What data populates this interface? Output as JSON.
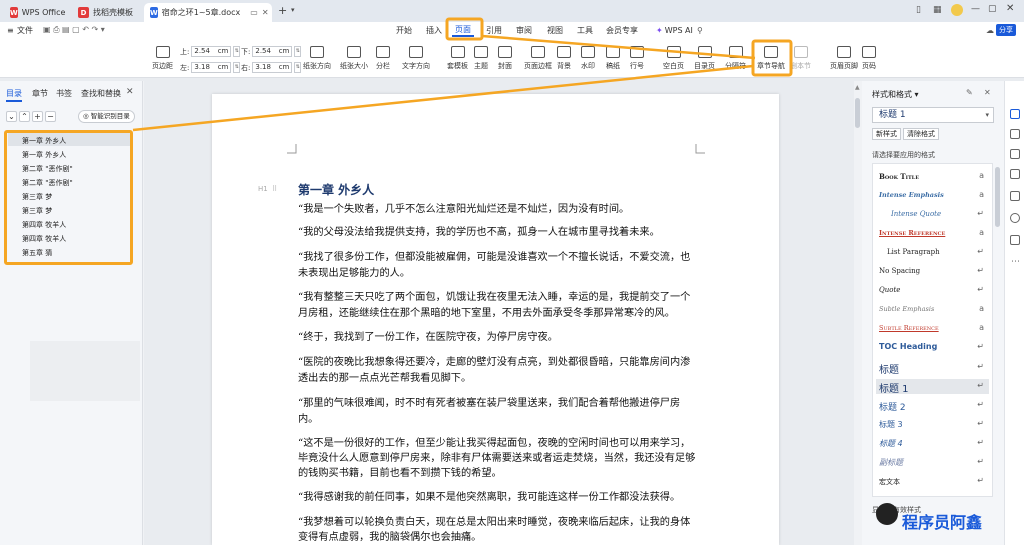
{
  "tabs": [
    {
      "label": "WPS Office",
      "icon": "wps-logo-icon"
    },
    {
      "label": "找稻壳模板",
      "icon": "docer-icon"
    },
    {
      "label": "宿命之环1~5章.docx",
      "icon": "word-doc-icon"
    }
  ],
  "menu": {
    "file": "文件",
    "items": [
      "开始",
      "插入",
      "页面",
      "引用",
      "审阅",
      "视图",
      "工具",
      "会员专享"
    ],
    "active": "页面",
    "wps_ai": "WPS AI",
    "share": "分享"
  },
  "ribbon": {
    "page_margin": "页边距",
    "top_label": "上:",
    "top_value": "2.54",
    "bottom_label": "下:",
    "bottom_value": "2.54",
    "left_label": "左:",
    "left_value": "3.18",
    "right_label": "右:",
    "right_value": "3.18",
    "unit": "cm",
    "buttons": [
      "纸张方向",
      "纸张大小",
      "分栏",
      "文字方向",
      "套模板",
      "主题",
      "封面",
      "页面边框",
      "背景",
      "水印",
      "稿纸",
      "行号",
      "空白页",
      "目录页",
      "分隔符",
      "章节导航",
      "删本节",
      "页眉页脚",
      "页码"
    ],
    "active_button": "章节导航",
    "disabled_button": "删本节"
  },
  "left_panel": {
    "tabs": [
      "目录",
      "章节",
      "书签",
      "查找和替换"
    ],
    "active_tab": "目录",
    "smart_toc": "智能识别目录",
    "toc_items": [
      "第一章 外乡人",
      "第一章 外乡人",
      "第二章 \"恶作剧\"",
      "第二章 \"恶作剧\"",
      "第三章 梦",
      "第三章 梦",
      "第四章 牧羊人",
      "第四章 牧羊人",
      "第五章 猜"
    ]
  },
  "document": {
    "heading_marker": "H1",
    "heading": "第一章 外乡人",
    "lines": [
      "“我是一个失败者，几乎不怎么注意阳光灿烂还是不灿烂，因为没有时间。",
      "“我的父母没法给我提供支持，我的学历也不高，孤身一人在城市里寻找着未来。",
      "“我找了很多份工作，但都没能被雇佣，可能是没谁喜欢一个不擅长说话，不爱交流，也",
      "未表现出足够能力的人。",
      "“我有整整三天只吃了两个面包，饥饿让我在夜里无法入睡，幸运的是，我提前交了一个",
      "月房租，还能继续住在那个黑暗的地下室里，不用去外面承受冬季那异常寒冷的风。",
      "“终于，我找到了一份工作，在医院守夜，为停尸房守夜。",
      "“医院的夜晚比我想象得还要冷，走廊的壁灯没有点亮，到处都很昏暗，只能靠房间内渗",
      "透出去的那一点点光芒帮我看见脚下。",
      "“那里的气味很难闻，时不时有死者被塞在装尸袋里送来，我们配合着帮他搬进停尸房",
      "内。",
      "“这不是一份很好的工作，但至少能让我买得起面包，夜晚的空闲时间也可以用来学习，",
      "毕竟没什么人愿意到停尸房来，除非有尸体需要送来或者运走焚烧，当然，我还没有足够",
      "的钱购买书籍，目前也看不到攒下钱的希望。",
      "“我得感谢我的前任同事，如果不是他突然离职，我可能连这样一份工作都没法获得。",
      "“我梦想着可以轮换负责白天，现在总是太阳出来时睡觉，夜晚来临后起床，让我的身体",
      "变得有点虚弱，我的脑袋偶尔也会抽痛。"
    ]
  },
  "right_panel": {
    "title": "样式和格式",
    "current_style": "标题 1",
    "new_style": "新样式",
    "clear_format": "清除格式",
    "apply_label": "请选择要应用的格式",
    "styles": [
      "Book Title",
      "Intense Emphasis",
      "Intense Quote",
      "Intense Reference",
      "List Paragraph",
      "No Spacing",
      "Quote",
      "Subtle Emphasis",
      "Subtle Reference",
      "TOC Heading",
      "标题",
      "标题 1",
      "标题 2",
      "标题 3",
      "标题 4",
      "副标题",
      "宏文本"
    ],
    "selected_style": "标题 1",
    "show_label": "显示：",
    "show_value": "有效样式"
  },
  "watermark": "程序员阿鑫",
  "colors": {
    "accent": "#f5a623",
    "brand": "#1a5ad9",
    "heading": "#1e3a6e"
  }
}
